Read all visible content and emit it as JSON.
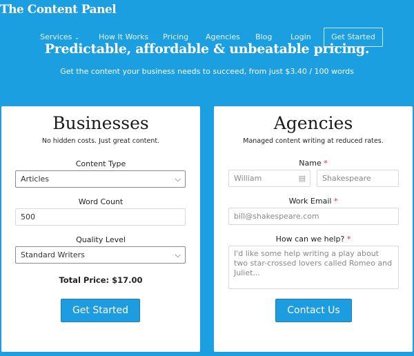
{
  "header": {
    "logo": "The Content Panel",
    "nav": [
      "Services",
      "How It Works",
      "Pricing",
      "Agencies",
      "Blog",
      "Login"
    ],
    "cta": "Get Started"
  },
  "hero": {
    "title": "Predictable, affordable & unbeatable pricing.",
    "subtitle": "Get the content your business needs to succeed, from just $3.40 / 100 words"
  },
  "businesses": {
    "title": "Businesses",
    "tagline": "No hidden costs. Just great content.",
    "content_type_label": "Content Type",
    "content_type": "Articles",
    "word_count_label": "Word Count",
    "word_count": "500",
    "quality_label": "Quality Level",
    "quality": "Standard Writers",
    "total": "Total Price: $17.00",
    "button": "Get Started"
  },
  "agencies": {
    "title": "Agencies",
    "tagline": "Managed content writing at reduced rates.",
    "name_label": "Name",
    "first_placeholder": "William",
    "last_placeholder": "Shakespeare",
    "email_label": "Work Email",
    "email_placeholder": "bill@shakespeare.com",
    "help_label": "How can we help?",
    "help_placeholder": "I'd like some help writing a play about two star-crossed lovers called Romeo and Juliet...",
    "required_mark": "*",
    "button": "Contact Us"
  }
}
